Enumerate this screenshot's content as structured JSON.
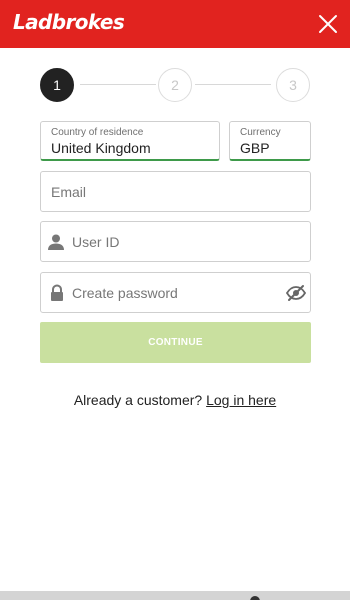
{
  "header": {
    "logo_text": "Ladbrokes",
    "close_icon": "close-icon",
    "brand_color": "#e1231f"
  },
  "stepper": {
    "steps": [
      "1",
      "2",
      "3"
    ],
    "active_step": 1
  },
  "form": {
    "country": {
      "label": "Country of residence",
      "value": "United Kingdom"
    },
    "currency": {
      "label": "Currency",
      "value": "GBP"
    },
    "email": {
      "placeholder": "Email"
    },
    "user_id": {
      "placeholder": "User ID",
      "icon": "user-icon"
    },
    "password": {
      "placeholder": "Create password",
      "icon": "lock-icon",
      "toggle_icon": "eye-off-icon"
    },
    "continue_label": "CONTINUE",
    "continue_color": "#c9e09f"
  },
  "footer": {
    "prompt": "Already a customer?",
    "login_link": "Log in here"
  }
}
